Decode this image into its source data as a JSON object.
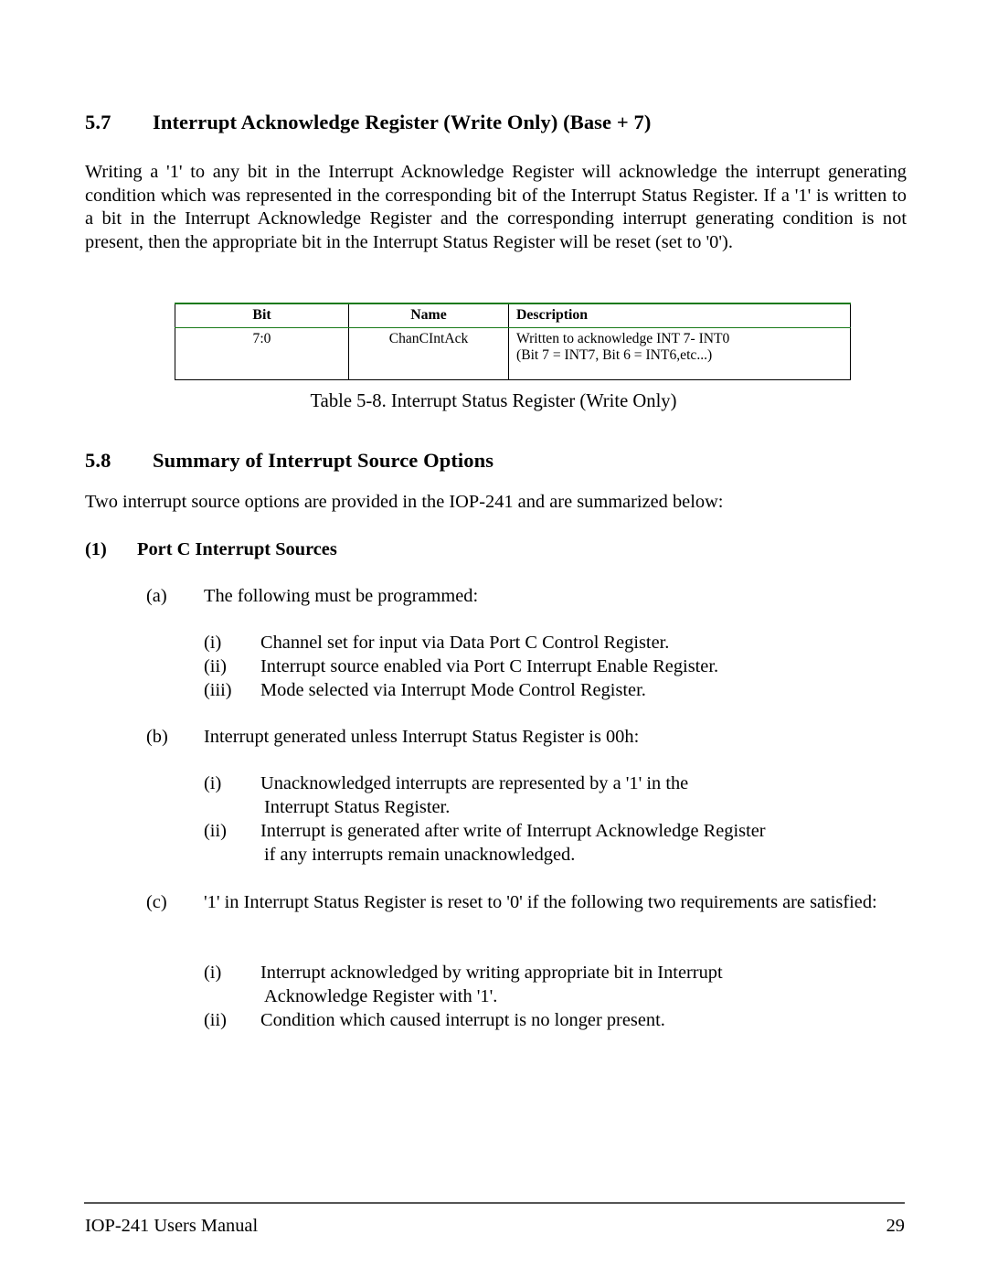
{
  "document": {
    "footer_left": "IOP-241 Users Manual",
    "page_number": "29"
  },
  "sections": {
    "s57": {
      "number": "5.7",
      "title": "Interrupt Acknowledge Register (Write Only) (Base + 7)",
      "paragraph": "Writing a '1' to any bit in the Interrupt Acknowledge Register will acknowledge the interrupt generating condition which was represented in the corresponding  bit of the Interrupt Status Register.   If a '1' is written to a bit in the Interrupt Acknowledge Register and the corresponding interrupt generating condition is not present, then the appropriate bit in the Interrupt Status Register will be reset (set to '0')."
    },
    "s58": {
      "number": "5.8",
      "title": "Summary of Interrupt Source Options",
      "paragraph": "Two interrupt source options are provided in the IOP-241 and are summarized below:"
    }
  },
  "table": {
    "headers": [
      "Bit",
      "Name",
      "Description"
    ],
    "rows": [
      {
        "bit": "7:0",
        "name": "ChanCIntAck",
        "description_line1": "Written to acknowledge INT 7- INT0",
        "description_line2": "(Bit 7 = INT7, Bit 6 = INT6,etc...)"
      }
    ],
    "caption": "Table 5-8.  Interrupt Status Register (Write Only)",
    "header_rule_color": "#1a7a1a",
    "border_color": "#000000",
    "shadow_color": "#000000"
  },
  "list": {
    "item1_marker": "(1)",
    "item1_text": "Port C Interrupt  Sources",
    "a": {
      "marker": "(a)",
      "text": "The following must be programmed:",
      "sub": [
        {
          "marker": "(i)",
          "text": "Channel set for input via Data Port C Control Register."
        },
        {
          "marker": "(ii)",
          "text": "Interrupt source enabled via Port C Interrupt Enable Register."
        },
        {
          "marker": "(iii)",
          "text": "Mode selected via Interrupt Mode Control Register."
        }
      ]
    },
    "b": {
      "marker": "(b)",
      "text": "Interrupt generated unless Interrupt Status Register is 00h:",
      "sub": [
        {
          "marker": "(i)",
          "line1": "Unacknowledged interrupts are represented by a '1' in the",
          "line2": "Interrupt Status Register."
        },
        {
          "marker": "(ii)",
          "line1": "Interrupt is generated after write of Interrupt Acknowledge Register",
          "line2": "if any interrupts remain unacknowledged."
        }
      ]
    },
    "c": {
      "marker": "(c)",
      "text": "'1' in Interrupt Status Register is reset to '0' if the following two requirements are satisfied:",
      "sub": [
        {
          "marker": "(i)",
          "line1": "Interrupt acknowledged by writing appropriate bit in Interrupt",
          "line2": "Acknowledge Register with '1'."
        },
        {
          "marker": "(ii)",
          "line1": "Condition which caused interrupt is no longer present.",
          "line2": ""
        }
      ]
    }
  }
}
